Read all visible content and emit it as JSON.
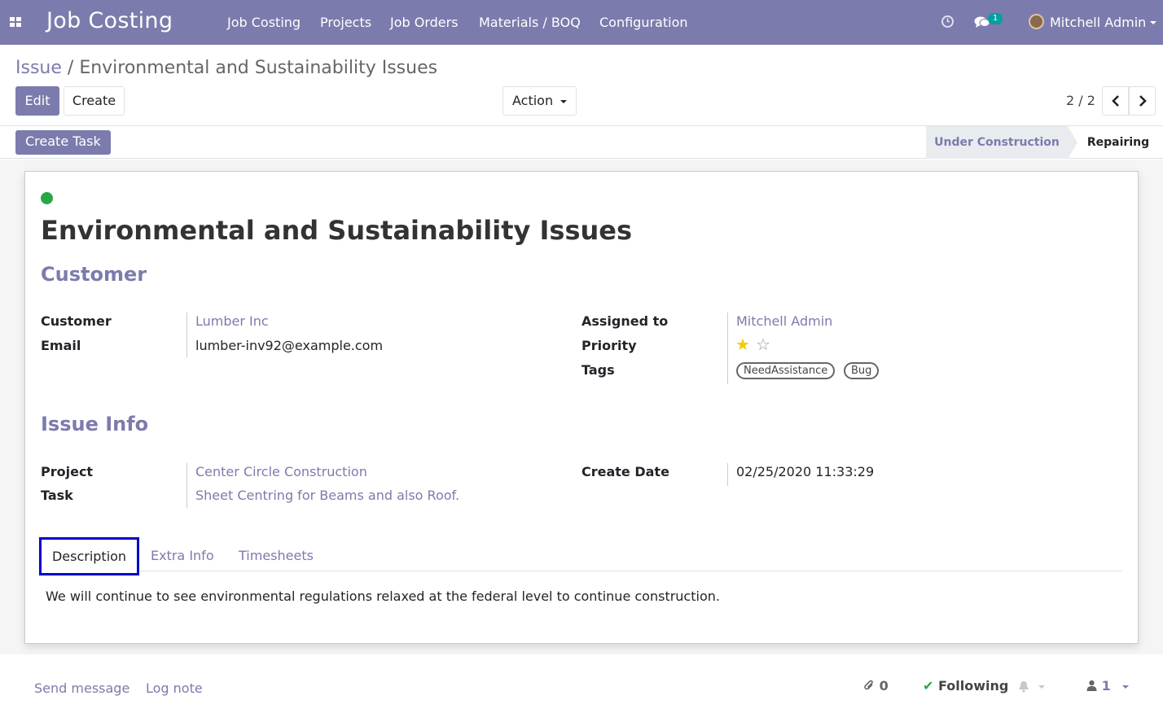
{
  "navbar": {
    "brand": "Job Costing",
    "menu": [
      "Job Costing",
      "Projects",
      "Job Orders",
      "Materials / BOQ",
      "Configuration"
    ],
    "messages_badge": "1",
    "user_name": "Mitchell Admin",
    "icons": [
      "apps-icon",
      "clock-icon",
      "chat-icon",
      "avatar"
    ]
  },
  "breadcrumb": {
    "parent": "Issue",
    "separator": "/",
    "current": "Environmental and Sustainability Issues"
  },
  "buttons": {
    "edit": "Edit",
    "create": "Create",
    "action": "Action",
    "create_task": "Create Task"
  },
  "pager": {
    "value": "2 / 2",
    "prev_icon": "chevron-left-icon",
    "next_icon": "chevron-right-icon"
  },
  "stages": [
    "Under Construction",
    "Repairing"
  ],
  "record": {
    "title": "Environmental and Sustainability Issues",
    "status_color": "#28a745"
  },
  "sections": {
    "customer": "Customer",
    "issue_info": "Issue Info"
  },
  "fields": {
    "customer_label": "Customer",
    "customer_value": "Lumber Inc",
    "email_label": "Email",
    "email_value": "lumber-inv92@example.com",
    "assigned_label": "Assigned to",
    "assigned_value": "Mitchell Admin",
    "priority_label": "Priority",
    "priority_value": 1,
    "priority_max": 2,
    "tags_label": "Tags",
    "tags": [
      "NeedAssistance",
      "Bug"
    ],
    "project_label": "Project",
    "project_value": "Center Circle Construction",
    "task_label": "Task",
    "task_value": "Sheet Centring for Beams and also Roof.",
    "create_date_label": "Create Date",
    "create_date_value": "02/25/2020 11:33:29"
  },
  "tabs": [
    "Description",
    "Extra Info",
    "Timesheets"
  ],
  "description": "We will continue to see environmental regulations relaxed at the federal level to continue construction.",
  "chatter": {
    "send_message": "Send message",
    "log_note": "Log note",
    "attachments_count": "0",
    "following": "Following",
    "followers_count": "1"
  },
  "colors": {
    "brand": "#7c7bad",
    "status_green": "#28a745",
    "star": "#f3cc00"
  }
}
